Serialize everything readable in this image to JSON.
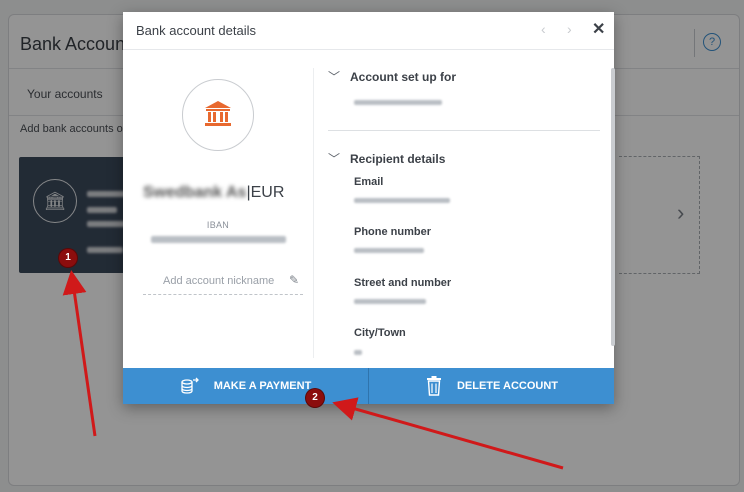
{
  "background": {
    "title": "Bank Account",
    "help": "?",
    "tabs": [
      "Your accounts"
    ],
    "hint": "Add bank accounts o",
    "account_card_icon": "bank-icon",
    "add_card_icon": "chevron-right-icon"
  },
  "modal": {
    "title": "Bank account details",
    "nav_prev": "‹",
    "nav_next": "›",
    "close": "✕",
    "bank": {
      "name_blurred": "Swedbank As",
      "currency": "EUR",
      "iban_label": "IBAN",
      "nickname_placeholder": "Add account nickname"
    },
    "sections": {
      "setup_title": "Account set up for",
      "recipient_title": "Recipient details",
      "fields": [
        "Email",
        "Phone number",
        "Street and number",
        "City/Town"
      ]
    },
    "actions": {
      "pay_label": "MAKE A PAYMENT",
      "delete_label": "DELETE ACCOUNT"
    },
    "colors": {
      "accent": "#3d8fd1",
      "bank_icon": "#e8692f",
      "annotation": "#d0191a"
    }
  },
  "annotations": {
    "badge1": "1",
    "badge2": "2"
  }
}
